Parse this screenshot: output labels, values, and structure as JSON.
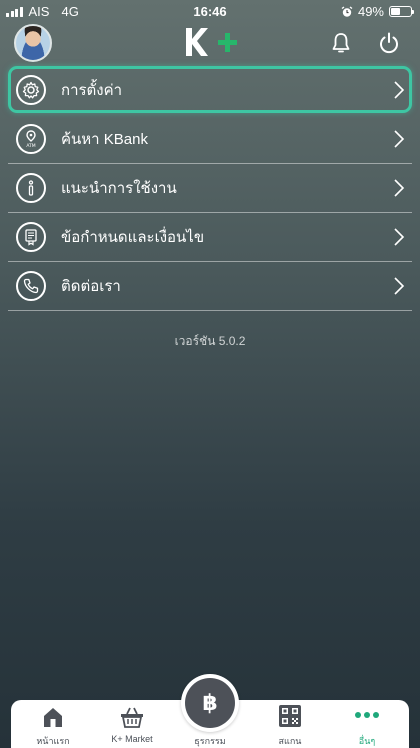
{
  "status_bar": {
    "carrier": "AIS",
    "network": "4G",
    "time": "16:46",
    "battery": "49%",
    "battery_level": 0.49,
    "alarm_icon": "alarm-clock-icon"
  },
  "header": {
    "logo_text": "K",
    "logo_plus": "+",
    "logo_colors": {
      "k": "#ffffff",
      "plus": "#27b66b"
    },
    "icons": [
      "bell-icon",
      "power-icon"
    ]
  },
  "menu": {
    "items": [
      {
        "label": "การตั้งค่า",
        "icon": "gear-icon",
        "selected": true
      },
      {
        "label": "ค้นหา KBank",
        "icon": "atm-location-icon",
        "selected": false
      },
      {
        "label": "แนะนำการใช้งาน",
        "icon": "info-icon",
        "selected": false
      },
      {
        "label": "ข้อกำหนดและเงื่อนไข",
        "icon": "document-icon",
        "selected": false
      },
      {
        "label": "ติดต่อเรา",
        "icon": "phone-icon",
        "selected": false
      }
    ],
    "highlight_color": "#3ec6a3"
  },
  "version_text": "เวอร์ชัน 5.0.2",
  "tabbar": {
    "tabs": [
      {
        "label": "หน้าแรก",
        "icon": "home-icon"
      },
      {
        "label": "K+ Market",
        "icon": "basket-icon"
      },
      {
        "label": "ธุรกรรม",
        "icon": "baht-icon",
        "center": "฿"
      },
      {
        "label": "สแกน",
        "icon": "qr-scan-icon"
      },
      {
        "label": "อื่นๆ",
        "icon": "more-dots-icon",
        "active": true
      }
    ],
    "active_color": "#1fa87b"
  }
}
